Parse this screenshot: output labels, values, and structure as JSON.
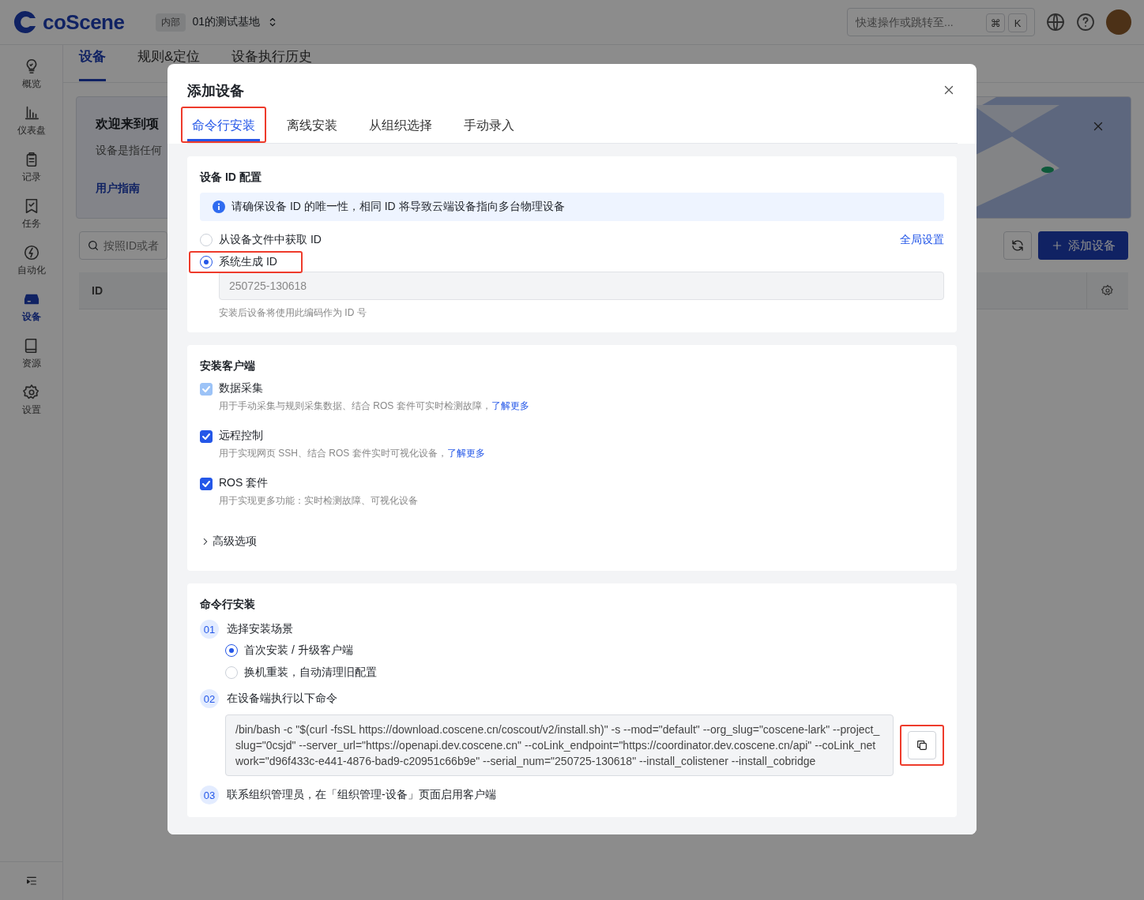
{
  "app_header": {
    "logo": "coScene",
    "workspace_badge": "内部",
    "project_name": "01的测试基地",
    "search": {
      "placeholder": "快速操作或跳转至..."
    },
    "shortcut_keys": [
      "⌘",
      "K"
    ]
  },
  "sidebar": {
    "items": [
      {
        "label": "概览",
        "selected": false
      },
      {
        "label": "仪表盘",
        "selected": false
      },
      {
        "label": "记录",
        "selected": false
      },
      {
        "label": "任务",
        "selected": false
      },
      {
        "label": "自动化",
        "selected": false
      },
      {
        "label": "设备",
        "selected": true
      },
      {
        "label": "资源",
        "selected": false
      },
      {
        "label": "设置",
        "selected": false
      }
    ]
  },
  "page_tabs": [
    {
      "label": "设备",
      "selected": true
    },
    {
      "label": "规则&定位",
      "selected": false
    },
    {
      "label": "设备执行历史",
      "selected": false
    }
  ],
  "welcome_banner": {
    "title": "欢迎来到项",
    "description": "设备是指任何",
    "link": "用户指南"
  },
  "device_search": {
    "placeholder": "按照ID或者"
  },
  "add_device_button": "添加设备",
  "table": {
    "columns": [
      "ID"
    ]
  },
  "dialog": {
    "title": "添加设备",
    "tabs": [
      {
        "label": "命令行安装",
        "selected": true,
        "highlighted": true
      },
      {
        "label": "离线安装",
        "selected": false,
        "highlighted": false
      },
      {
        "label": "从组织选择",
        "selected": false,
        "highlighted": false
      },
      {
        "label": "手动录入",
        "selected": false,
        "highlighted": false
      }
    ],
    "id_config": {
      "heading": "设备 ID 配置",
      "notice": "请确保设备 ID 的唯一性，相同 ID 将导致云端设备指向多台物理设备",
      "global_settings_link": "全局设置",
      "options": [
        {
          "label": "从设备文件中获取 ID",
          "selected": false,
          "highlighted": false
        },
        {
          "label": "系统生成 ID",
          "selected": true,
          "highlighted": true
        }
      ],
      "id_value": "250725-130618",
      "hint": "安装后设备将使用此编码作为 ID 号"
    },
    "client": {
      "heading": "安装客户端",
      "features": [
        {
          "label": "数据采集",
          "checked": true,
          "disabled": true,
          "description": "用于手动采集与规则采集数据、结合 ROS 套件可实时检测故障，",
          "link": "了解更多"
        },
        {
          "label": "远程控制",
          "checked": true,
          "disabled": false,
          "description": "用于实现网页 SSH、结合 ROS 套件实时可视化设备，",
          "link": "了解更多"
        },
        {
          "label": "ROS 套件",
          "checked": true,
          "disabled": false,
          "description": "用于实现更多功能：实时检测故障、可视化设备"
        }
      ],
      "advanced": {
        "label": "高级选项",
        "expanded": false
      }
    },
    "cli": {
      "heading": "命令行安装",
      "steps": [
        {
          "number": "01",
          "title": "选择安装场景",
          "kind": "choice",
          "options": [
            {
              "label": "首次安装 / 升级客户端",
              "selected": true
            },
            {
              "label": "换机重装，自动清理旧配置",
              "selected": false
            }
          ]
        },
        {
          "number": "02",
          "title": "在设备端执行以下命令",
          "kind": "command",
          "command": "/bin/bash -c \"$(curl -fsSL https://download.coscene.cn/coscout/v2/install.sh)\" -s --mod=\"default\" --org_slug=\"coscene-lark\" --project_slug=\"0csjd\" --server_url=\"https://openapi.dev.coscene.cn\" --coLink_endpoint=\"https://coordinator.dev.coscene.cn/api\" --coLink_network=\"d96f433c-e441-4876-bad9-c20951c66b9e\" --serial_num=\"250725-130618\" --install_colistener --install_cobridge",
          "copy_highlighted": true
        },
        {
          "number": "03",
          "title": "联系组织管理员，在「组织管理-设备」页面启用客户端",
          "kind": "text"
        }
      ]
    }
  }
}
